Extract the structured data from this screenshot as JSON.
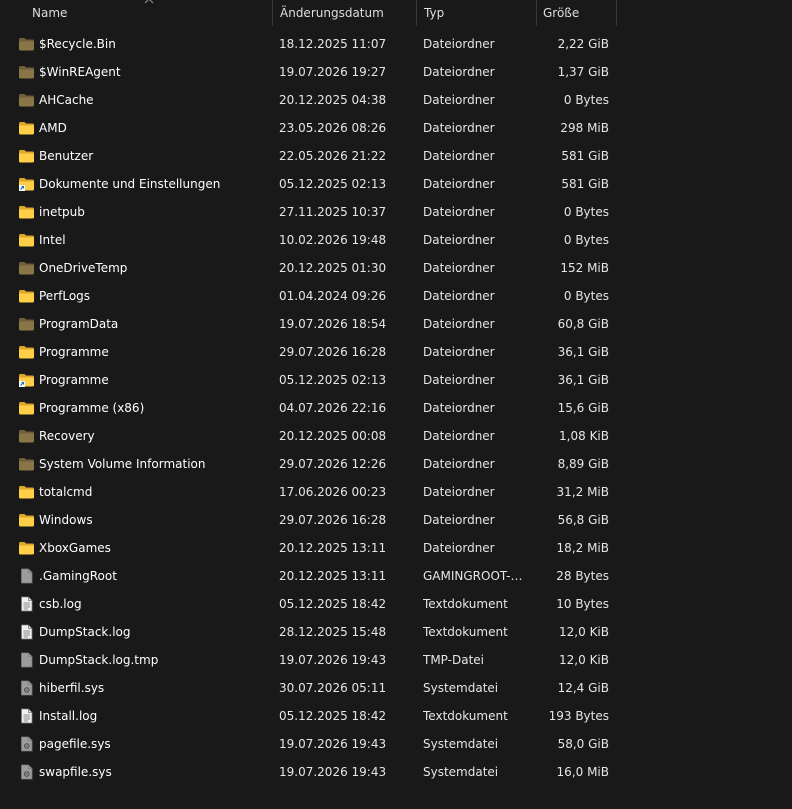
{
  "columns": {
    "name": "Name",
    "date": "Änderungsdatum",
    "type": "Typ",
    "size": "Größe"
  },
  "colors": {
    "background": "#191919",
    "folder": "#ffcf48",
    "folder_dim": "#8a7548",
    "file": "#e8e8e8"
  },
  "files": [
    {
      "name": "$Recycle.Bin",
      "date": "18.12.2025 11:07",
      "type": "Dateiordner",
      "size": "2,22 GiB",
      "icon": "folder-hidden-icon"
    },
    {
      "name": "$WinREAgent",
      "date": "19.07.2026 19:27",
      "type": "Dateiordner",
      "size": "1,37 GiB",
      "icon": "folder-hidden-icon"
    },
    {
      "name": "AHCache",
      "date": "20.12.2025 04:38",
      "type": "Dateiordner",
      "size": "0 Bytes",
      "icon": "folder-hidden-icon"
    },
    {
      "name": "AMD",
      "date": "23.05.2026 08:26",
      "type": "Dateiordner",
      "size": "298 MiB",
      "icon": "folder-icon"
    },
    {
      "name": "Benutzer",
      "date": "22.05.2026 21:22",
      "type": "Dateiordner",
      "size": "581 GiB",
      "icon": "folder-icon"
    },
    {
      "name": "Dokumente und Einstellungen",
      "date": "05.12.2025 02:13",
      "type": "Dateiordner",
      "size": "581 GiB",
      "icon": "folder-shortcut-icon"
    },
    {
      "name": "inetpub",
      "date": "27.11.2025 10:37",
      "type": "Dateiordner",
      "size": "0 Bytes",
      "icon": "folder-icon"
    },
    {
      "name": "Intel",
      "date": "10.02.2026 19:48",
      "type": "Dateiordner",
      "size": "0 Bytes",
      "icon": "folder-icon"
    },
    {
      "name": "OneDriveTemp",
      "date": "20.12.2025 01:30",
      "type": "Dateiordner",
      "size": "152 MiB",
      "icon": "folder-hidden-icon"
    },
    {
      "name": "PerfLogs",
      "date": "01.04.2024 09:26",
      "type": "Dateiordner",
      "size": "0 Bytes",
      "icon": "folder-icon"
    },
    {
      "name": "ProgramData",
      "date": "19.07.2026 18:54",
      "type": "Dateiordner",
      "size": "60,8 GiB",
      "icon": "folder-hidden-icon"
    },
    {
      "name": "Programme",
      "date": "29.07.2026 16:28",
      "type": "Dateiordner",
      "size": "36,1 GiB",
      "icon": "folder-icon"
    },
    {
      "name": "Programme",
      "date": "05.12.2025 02:13",
      "type": "Dateiordner",
      "size": "36,1 GiB",
      "icon": "folder-shortcut-icon"
    },
    {
      "name": "Programme (x86)",
      "date": "04.07.2026 22:16",
      "type": "Dateiordner",
      "size": "15,6 GiB",
      "icon": "folder-icon"
    },
    {
      "name": "Recovery",
      "date": "20.12.2025 00:08",
      "type": "Dateiordner",
      "size": "1,08 KiB",
      "icon": "folder-hidden-icon"
    },
    {
      "name": "System Volume Information",
      "date": "29.07.2026 12:26",
      "type": "Dateiordner",
      "size": "8,89 GiB",
      "icon": "folder-hidden-icon"
    },
    {
      "name": "totalcmd",
      "date": "17.06.2026 00:23",
      "type": "Dateiordner",
      "size": "31,2 MiB",
      "icon": "folder-icon"
    },
    {
      "name": "Windows",
      "date": "29.07.2026 16:28",
      "type": "Dateiordner",
      "size": "56,8 GiB",
      "icon": "folder-icon"
    },
    {
      "name": "XboxGames",
      "date": "20.12.2025 13:11",
      "type": "Dateiordner",
      "size": "18,2 MiB",
      "icon": "folder-icon"
    },
    {
      "name": ".GamingRoot",
      "date": "20.12.2025 13:11",
      "type": "GAMINGROOT-Da...",
      "size": "28 Bytes",
      "icon": "file-hidden-icon"
    },
    {
      "name": "csb.log",
      "date": "05.12.2025 18:42",
      "type": "Textdokument",
      "size": "10 Bytes",
      "icon": "text-file-icon"
    },
    {
      "name": "DumpStack.log",
      "date": "28.12.2025 15:48",
      "type": "Textdokument",
      "size": "12,0 KiB",
      "icon": "text-file-icon"
    },
    {
      "name": "DumpStack.log.tmp",
      "date": "19.07.2026 19:43",
      "type": "TMP-Datei",
      "size": "12,0 KiB",
      "icon": "file-hidden-icon"
    },
    {
      "name": "hiberfil.sys",
      "date": "30.07.2026 05:11",
      "type": "Systemdatei",
      "size": "12,4 GiB",
      "icon": "system-file-icon"
    },
    {
      "name": "Install.log",
      "date": "05.12.2025 18:42",
      "type": "Textdokument",
      "size": "193 Bytes",
      "icon": "text-file-icon"
    },
    {
      "name": "pagefile.sys",
      "date": "19.07.2026 19:43",
      "type": "Systemdatei",
      "size": "58,0 GiB",
      "icon": "system-file-icon"
    },
    {
      "name": "swapfile.sys",
      "date": "19.07.2026 19:43",
      "type": "Systemdatei",
      "size": "16,0 MiB",
      "icon": "system-file-icon"
    }
  ]
}
